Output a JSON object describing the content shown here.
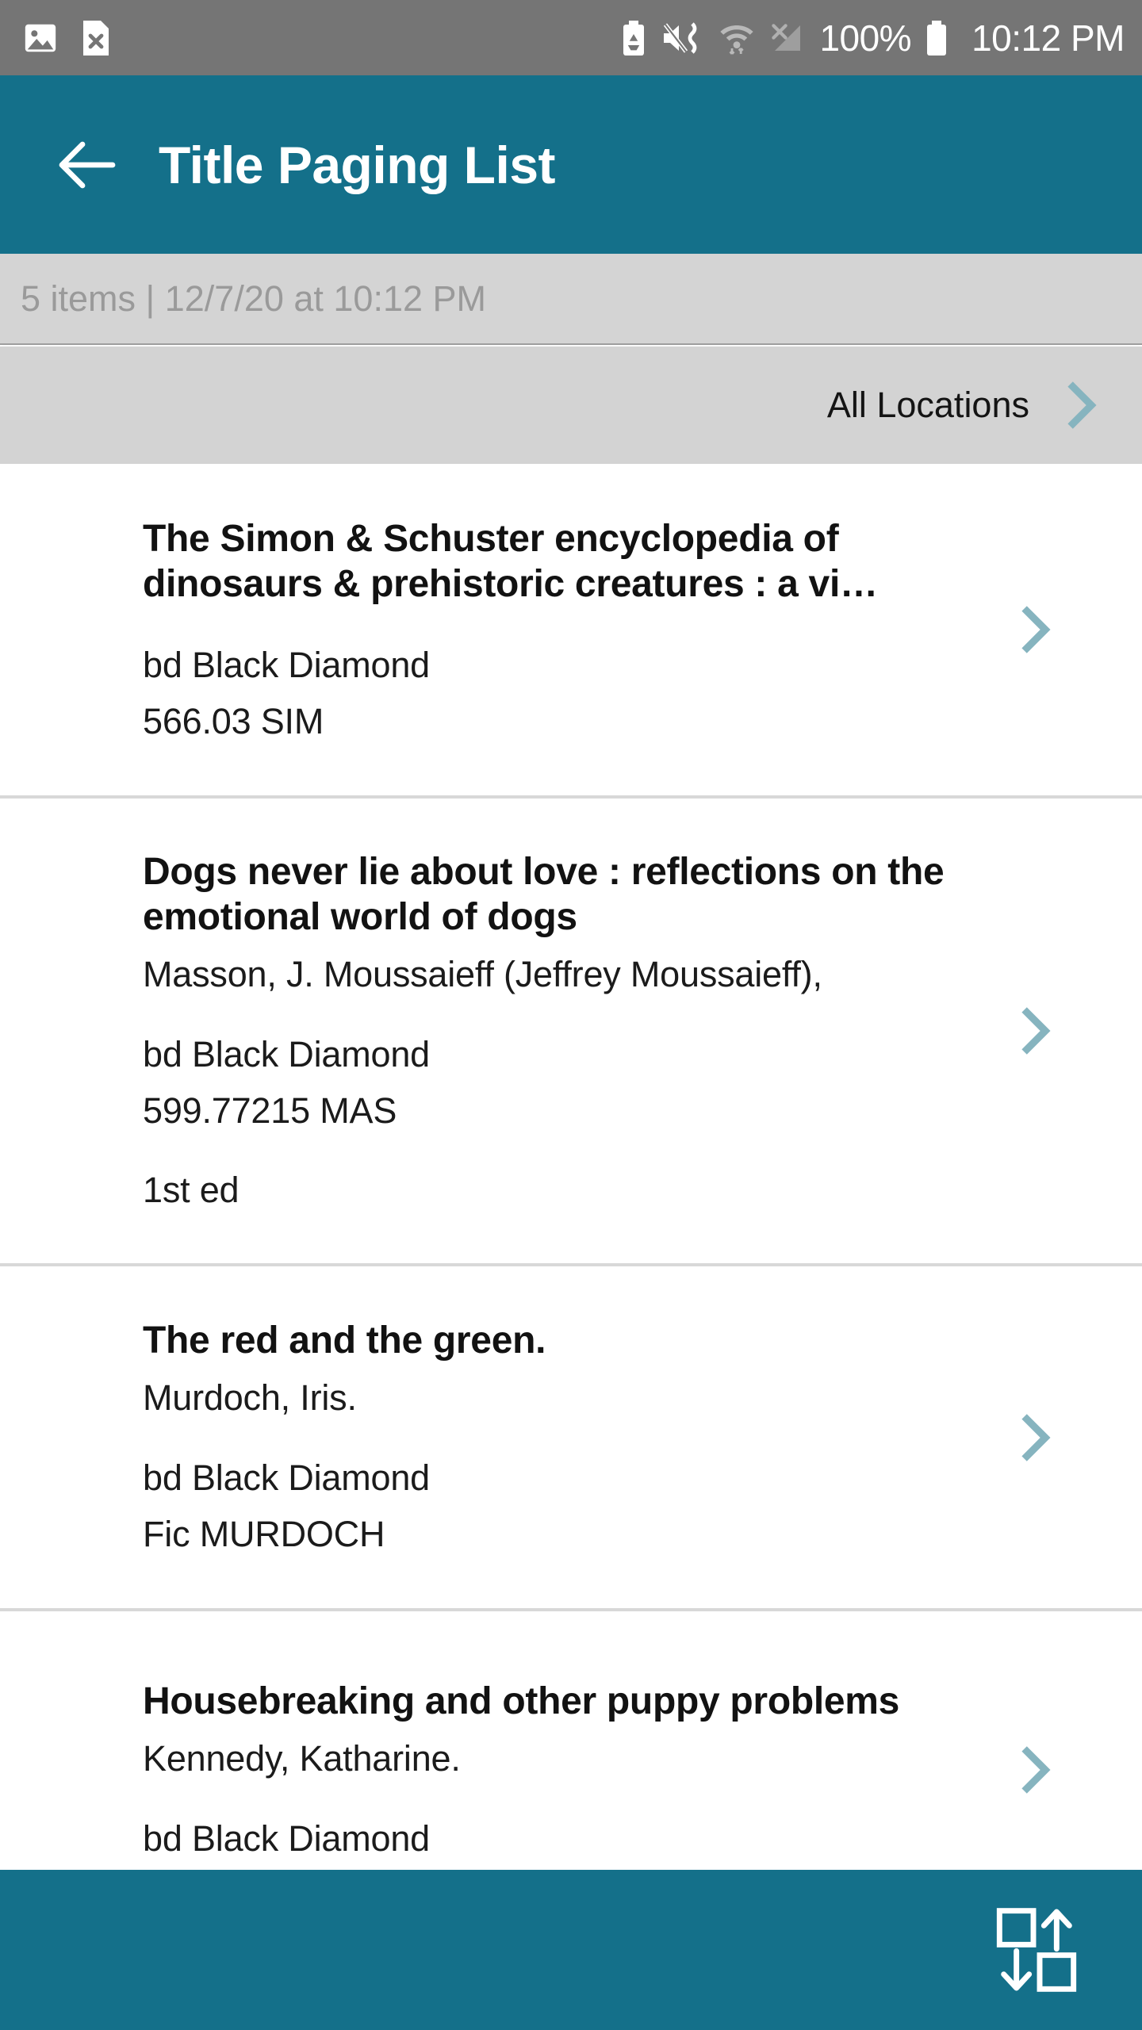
{
  "status_bar": {
    "background": "#757575",
    "left_icons": [
      {
        "name": "screenshot-image-icon",
        "label": "screenshot"
      },
      {
        "name": "file-error-icon",
        "label": "file-x"
      }
    ],
    "right_icons": [
      {
        "name": "battery-saver-icon",
        "label": "battery-saver"
      },
      {
        "name": "mute-vibrate-icon",
        "label": "sound-off-vibrate"
      },
      {
        "name": "wifi-icon",
        "label": "wifi"
      },
      {
        "name": "no-signal-icon",
        "label": "cellular-no-service"
      }
    ],
    "battery_percent": "100%",
    "time": "10:12 PM"
  },
  "header": {
    "background": "#14708A",
    "back_icon": "arrow-left-icon",
    "title": "Title Paging List"
  },
  "subheader": {
    "background": "#D4D4D4",
    "summary": "5 items | 12/7/20 at 10:12 PM",
    "item_count": "5 items",
    "timestamp": "12/7/20 at 10:12 PM"
  },
  "filter": {
    "background": "#D3D3D3",
    "label": "All Locations",
    "chevron_icon": "chevron-right-icon",
    "chevron_color": "#86B4BF"
  },
  "list": {
    "chevron_color": "#86B4BF",
    "items": [
      {
        "title": "The Simon & Schuster encyclopedia of dinosaurs & prehistoric creatures : a vi…",
        "author": "",
        "location": "bd Black Diamond",
        "call_number": "566.03 SIM",
        "edition": ""
      },
      {
        "title": "Dogs never lie about love : reflections on the emotional world of dogs",
        "author": "Masson, J. Moussaieff (Jeffrey Moussaieff),",
        "location": "bd Black Diamond",
        "call_number": "599.77215 MAS",
        "edition": "1st ed"
      },
      {
        "title": "The red and the green.",
        "author": "Murdoch, Iris.",
        "location": "bd Black Diamond",
        "call_number": "Fic MURDOCH",
        "edition": ""
      },
      {
        "title": "Housebreaking and other puppy problems",
        "author": "Kennedy, Katharine.",
        "location": "bd Black Diamond",
        "call_number": "",
        "edition": ""
      }
    ]
  },
  "bottom_bar": {
    "background": "#14708A",
    "action_icon": "transfer-sort-icon"
  }
}
